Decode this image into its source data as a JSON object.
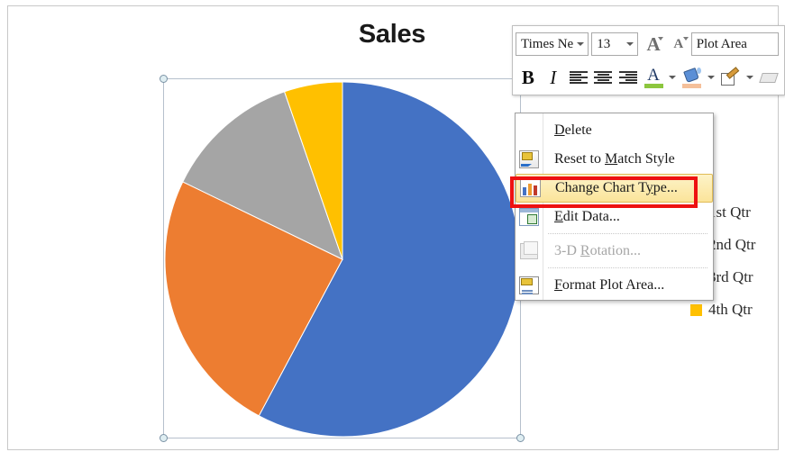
{
  "window": {
    "background": "#ffffff",
    "frame_border": "#c8c8c8"
  },
  "chart": {
    "title": "Sales",
    "selected_element": "Plot Area"
  },
  "chart_data": {
    "type": "pie",
    "title": "Sales",
    "categories": [
      "1st Qtr",
      "2nd Qtr",
      "3rd Qtr",
      "4th Qtr"
    ],
    "values": [
      57.8,
      24.4,
      12.5,
      5.3
    ],
    "colors": [
      "#4472C4",
      "#ED7D31",
      "#A5A5A5",
      "#FFC000"
    ],
    "start_angle": 0,
    "legend_position": "right",
    "grid": false,
    "xlabel": "",
    "ylabel": ""
  },
  "legend": {
    "items": [
      {
        "label": "1st Qtr",
        "color": "#4472C4"
      },
      {
        "label": "2nd Qtr",
        "color": "#ED7D31"
      },
      {
        "label": "3rd Qtr",
        "color": "#A5A5A5"
      },
      {
        "label": "4th Qtr",
        "color": "#FFC000"
      }
    ]
  },
  "mini_toolbar": {
    "font_name": "Times Ne",
    "font_size": "13",
    "grow_font_label": "A",
    "shrink_font_label": "A",
    "chart_element": "Plot Area",
    "bold_label": "B",
    "italic_label": "I",
    "icons": {
      "font_name_arrow": "chevron-down-icon",
      "font_size_arrow": "chevron-down-icon",
      "grow_font": "grow-font-icon",
      "shrink_font": "shrink-font-icon",
      "align_left": "align-left-icon",
      "align_center": "align-center-icon",
      "align_right": "align-right-icon",
      "font_color": "font-color-icon",
      "fill_color": "fill-color-icon",
      "format_pen": "format-pen-icon",
      "brush": "brush-icon"
    },
    "font_color_swatch": "#8CC63E",
    "fill_color_swatch": "#F5C09A"
  },
  "context_menu": {
    "items": [
      {
        "label": "Delete",
        "icon": "",
        "disabled": false,
        "highlighted": false,
        "accel": "D"
      },
      {
        "label": "Reset to Match Style",
        "icon": "reset-style-icon",
        "disabled": false,
        "highlighted": false,
        "accel": "M"
      },
      {
        "label": "Change Chart Type...",
        "icon": "change-chart-type-icon",
        "disabled": false,
        "highlighted": true,
        "accel": "y"
      },
      {
        "label": "Edit Data...",
        "icon": "edit-data-icon",
        "disabled": false,
        "highlighted": false,
        "accel": "E"
      },
      {
        "label": "3-D Rotation...",
        "icon": "3d-rotation-icon",
        "disabled": true,
        "highlighted": false,
        "accel": "R"
      },
      {
        "label": "Format Plot Area...",
        "icon": "format-plot-area-icon",
        "disabled": false,
        "highlighted": false,
        "accel": "F"
      }
    ],
    "highlight_color": "#FBE49A",
    "annotation_box_color": "#EE1111"
  }
}
